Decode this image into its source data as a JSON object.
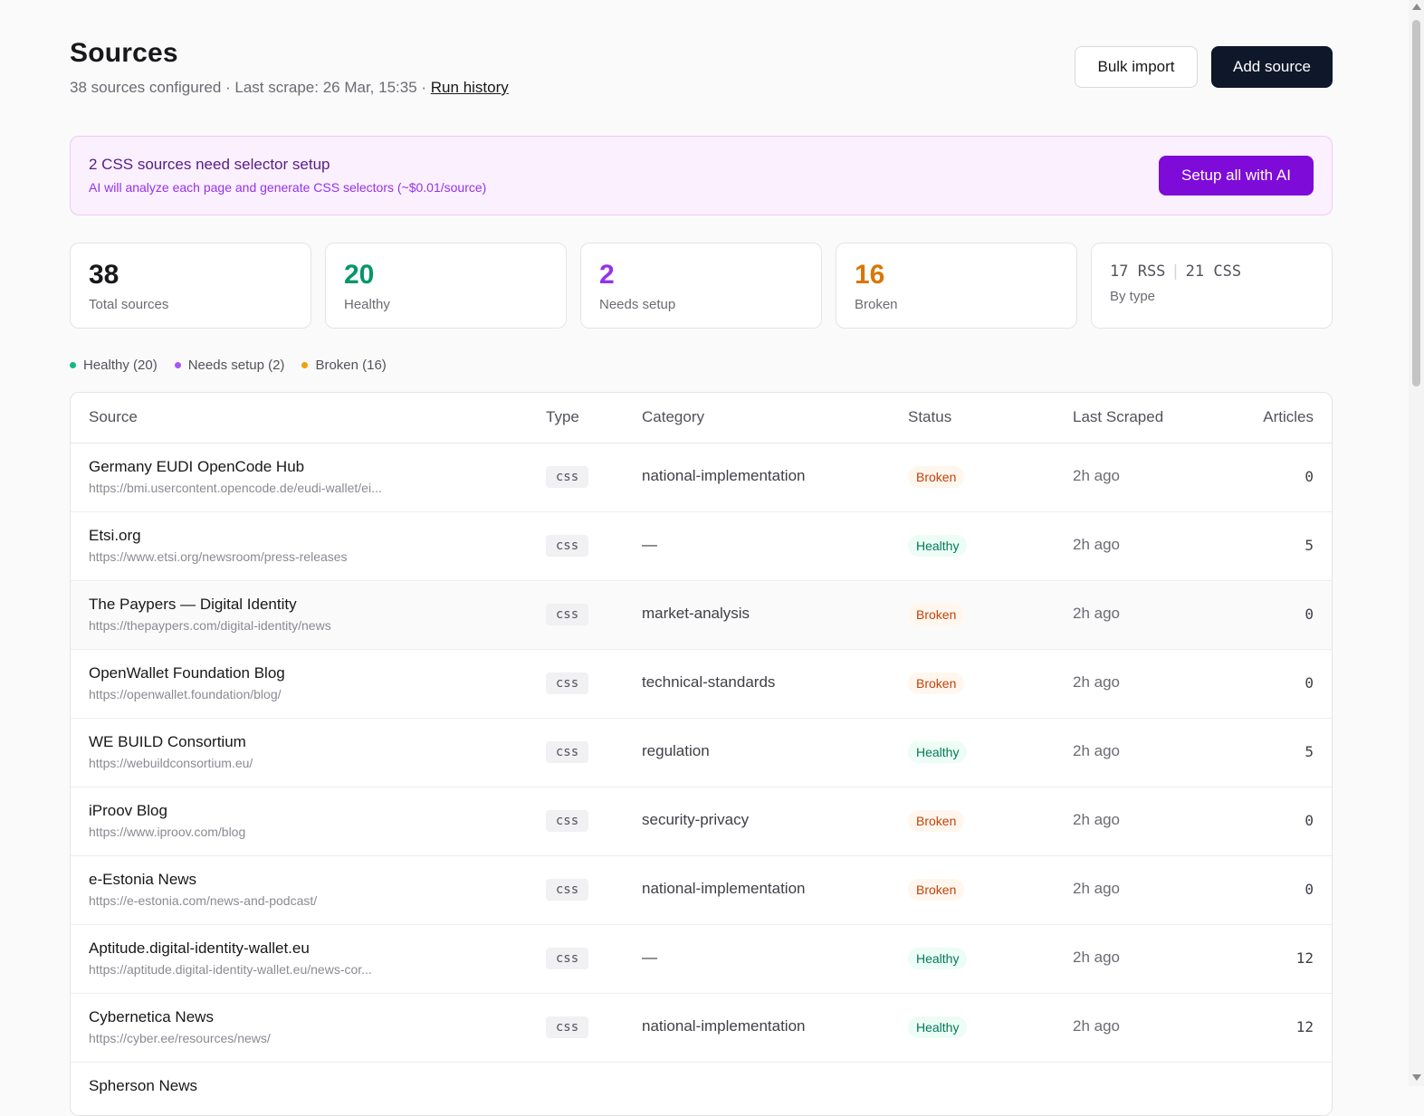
{
  "header": {
    "title": "Sources",
    "summary": "38 sources configured · Last scrape: 26 Mar, 15:35 · ",
    "run_history_label": "Run history",
    "bulk_import_label": "Bulk import",
    "add_source_label": "Add source"
  },
  "banner": {
    "title": "2 CSS sources need selector setup",
    "subtitle": "AI will analyze each page and generate CSS selectors (~$0.01/source)",
    "action_label": "Setup all with AI"
  },
  "stats": {
    "total": {
      "value": "38",
      "label": "Total sources",
      "color": "#18181b"
    },
    "healthy": {
      "value": "20",
      "label": "Healthy",
      "color": "#059669"
    },
    "needs_setup": {
      "value": "2",
      "label": "Needs setup",
      "color": "#9333ea"
    },
    "broken": {
      "value": "16",
      "label": "Broken",
      "color": "#d97706"
    },
    "by_type": {
      "rss": "17 RSS",
      "separator": "|",
      "css": "21 CSS",
      "label": "By type"
    }
  },
  "legend": [
    {
      "label": "Healthy (20)",
      "color": "#10b981"
    },
    {
      "label": "Needs setup (2)",
      "color": "#a855f7"
    },
    {
      "label": "Broken (16)",
      "color": "#f59e0b"
    }
  ],
  "table": {
    "columns": {
      "source": "Source",
      "type": "Type",
      "category": "Category",
      "status": "Status",
      "last_scraped": "Last Scraped",
      "articles": "Articles"
    },
    "rows": [
      {
        "name": "Germany EUDI OpenCode Hub",
        "url": "https://bmi.usercontent.opencode.de/eudi-wallet/ei...",
        "type": "css",
        "category": "national-implementation",
        "status": "Broken",
        "last_scraped": "2h ago",
        "articles": "0"
      },
      {
        "name": "Etsi.org",
        "url": "https://www.etsi.org/newsroom/press-releases",
        "type": "css",
        "category": "—",
        "status": "Healthy",
        "last_scraped": "2h ago",
        "articles": "5"
      },
      {
        "name": "The Paypers — Digital Identity",
        "url": "https://thepaypers.com/digital-identity/news",
        "type": "css",
        "category": "market-analysis",
        "status": "Broken",
        "last_scraped": "2h ago",
        "articles": "0"
      },
      {
        "name": "OpenWallet Foundation Blog",
        "url": "https://openwallet.foundation/blog/",
        "type": "css",
        "category": "technical-standards",
        "status": "Broken",
        "last_scraped": "2h ago",
        "articles": "0"
      },
      {
        "name": "WE BUILD Consortium",
        "url": "https://webuildconsortium.eu/",
        "type": "css",
        "category": "regulation",
        "status": "Healthy",
        "last_scraped": "2h ago",
        "articles": "5"
      },
      {
        "name": "iProov Blog",
        "url": "https://www.iproov.com/blog",
        "type": "css",
        "category": "security-privacy",
        "status": "Broken",
        "last_scraped": "2h ago",
        "articles": "0"
      },
      {
        "name": "e-Estonia News",
        "url": "https://e-estonia.com/news-and-podcast/",
        "type": "css",
        "category": "national-implementation",
        "status": "Broken",
        "last_scraped": "2h ago",
        "articles": "0"
      },
      {
        "name": "Aptitude.digital-identity-wallet.eu",
        "url": "https://aptitude.digital-identity-wallet.eu/news-cor...",
        "type": "css",
        "category": "—",
        "status": "Healthy",
        "last_scraped": "2h ago",
        "articles": "12"
      },
      {
        "name": "Cybernetica News",
        "url": "https://cyber.ee/resources/news/",
        "type": "css",
        "category": "national-implementation",
        "status": "Healthy",
        "last_scraped": "2h ago",
        "articles": "12"
      },
      {
        "name": "Spherson News",
        "url": "",
        "type": "",
        "category": "",
        "status": "",
        "last_scraped": "",
        "articles": ""
      }
    ]
  }
}
